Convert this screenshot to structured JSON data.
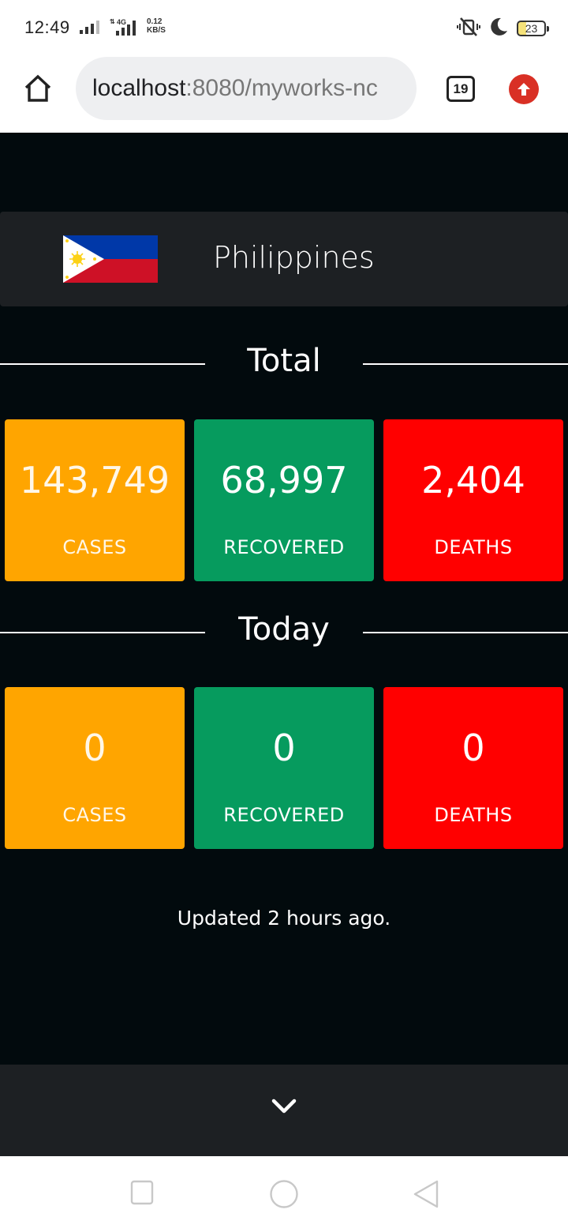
{
  "status_bar": {
    "time": "12:49",
    "net_type": "4G",
    "net_speed_value": "0.12",
    "net_speed_unit": "KB/S",
    "battery_level": "23"
  },
  "browser": {
    "url_host": "localhost",
    "url_rest": ":8080/myworks-nc",
    "tab_count": "19"
  },
  "country": {
    "name": "Philippines"
  },
  "total": {
    "heading": "Total",
    "cases_value": "143,749",
    "cases_label": "CASES",
    "recovered_value": "68,997",
    "recovered_label": "RECOVERED",
    "deaths_value": "2,404",
    "deaths_label": "DEATHS"
  },
  "today": {
    "heading": "Today",
    "cases_value": "0",
    "cases_label": "CASES",
    "recovered_value": "0",
    "recovered_label": "RECOVERED",
    "deaths_value": "0",
    "deaths_label": "DEATHS"
  },
  "footer": {
    "updated_text": "Updated 2 hours ago."
  },
  "colors": {
    "cases": "#ffa500",
    "recovered": "#069b5e",
    "deaths": "#ff0000",
    "page_bg": "#020a0d",
    "panel_bg": "#1d2023"
  },
  "icons": {
    "home": "home-icon",
    "update": "update-arrow-icon",
    "expand": "chevron-down-icon",
    "nav_recent": "square-icon",
    "nav_home": "circle-icon",
    "nav_back": "triangle-back-icon"
  }
}
